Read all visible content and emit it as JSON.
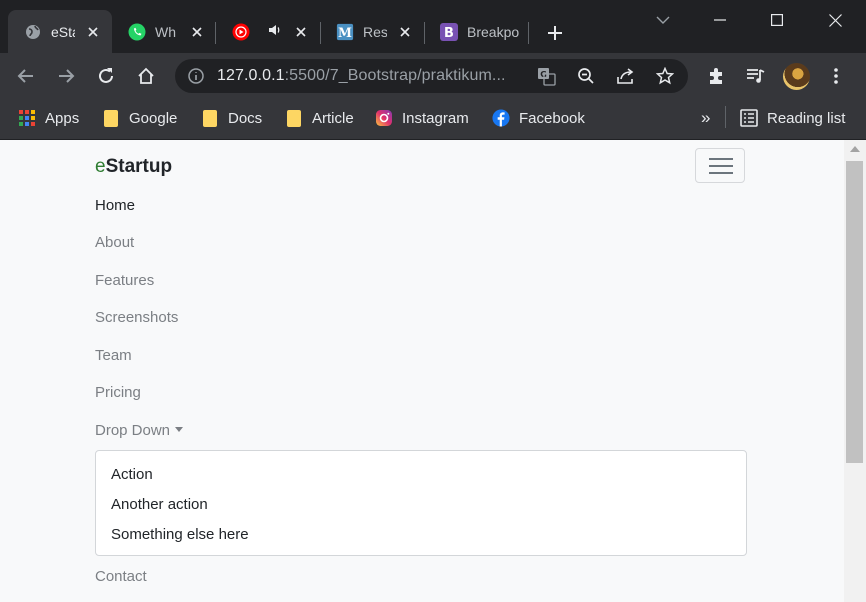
{
  "browser": {
    "tabs": [
      {
        "title": "eSta",
        "icon": "globe-icon",
        "active": true
      },
      {
        "title": "Wh",
        "icon": "whatsapp-icon"
      },
      {
        "title": "",
        "icon": "youtube-music-icon",
        "audio": true
      },
      {
        "title": "Res",
        "icon": "m-logo-icon"
      },
      {
        "title": "Breakpo",
        "icon": "bootstrap-icon"
      }
    ],
    "address": {
      "host": "127.0.0.1",
      "rest": ":5500/7_Bootstrap/praktikum..."
    },
    "bookmarks": [
      {
        "label": "Apps",
        "icon": "apps-grid-icon"
      },
      {
        "label": "Google",
        "icon": "folder-icon"
      },
      {
        "label": "Docs",
        "icon": "folder-icon"
      },
      {
        "label": "Article",
        "icon": "folder-icon"
      },
      {
        "label": "Instagram",
        "icon": "instagram-icon"
      },
      {
        "label": "Facebook",
        "icon": "facebook-icon"
      }
    ],
    "overflow": "»",
    "reading_list": "Reading list"
  },
  "page": {
    "brand_first": "e",
    "brand_rest": "Startup",
    "nav": [
      "Home",
      "About",
      "Features",
      "Screenshots",
      "Team",
      "Pricing",
      "Drop Down",
      "Contact"
    ],
    "dropdown": [
      "Action",
      "Another action",
      "Something else here"
    ]
  },
  "colors": {
    "accent": "#2f7d32",
    "chrome_dark": "#202124",
    "chrome_toolbar": "#35363a",
    "page_bg": "#f8f9fa"
  }
}
